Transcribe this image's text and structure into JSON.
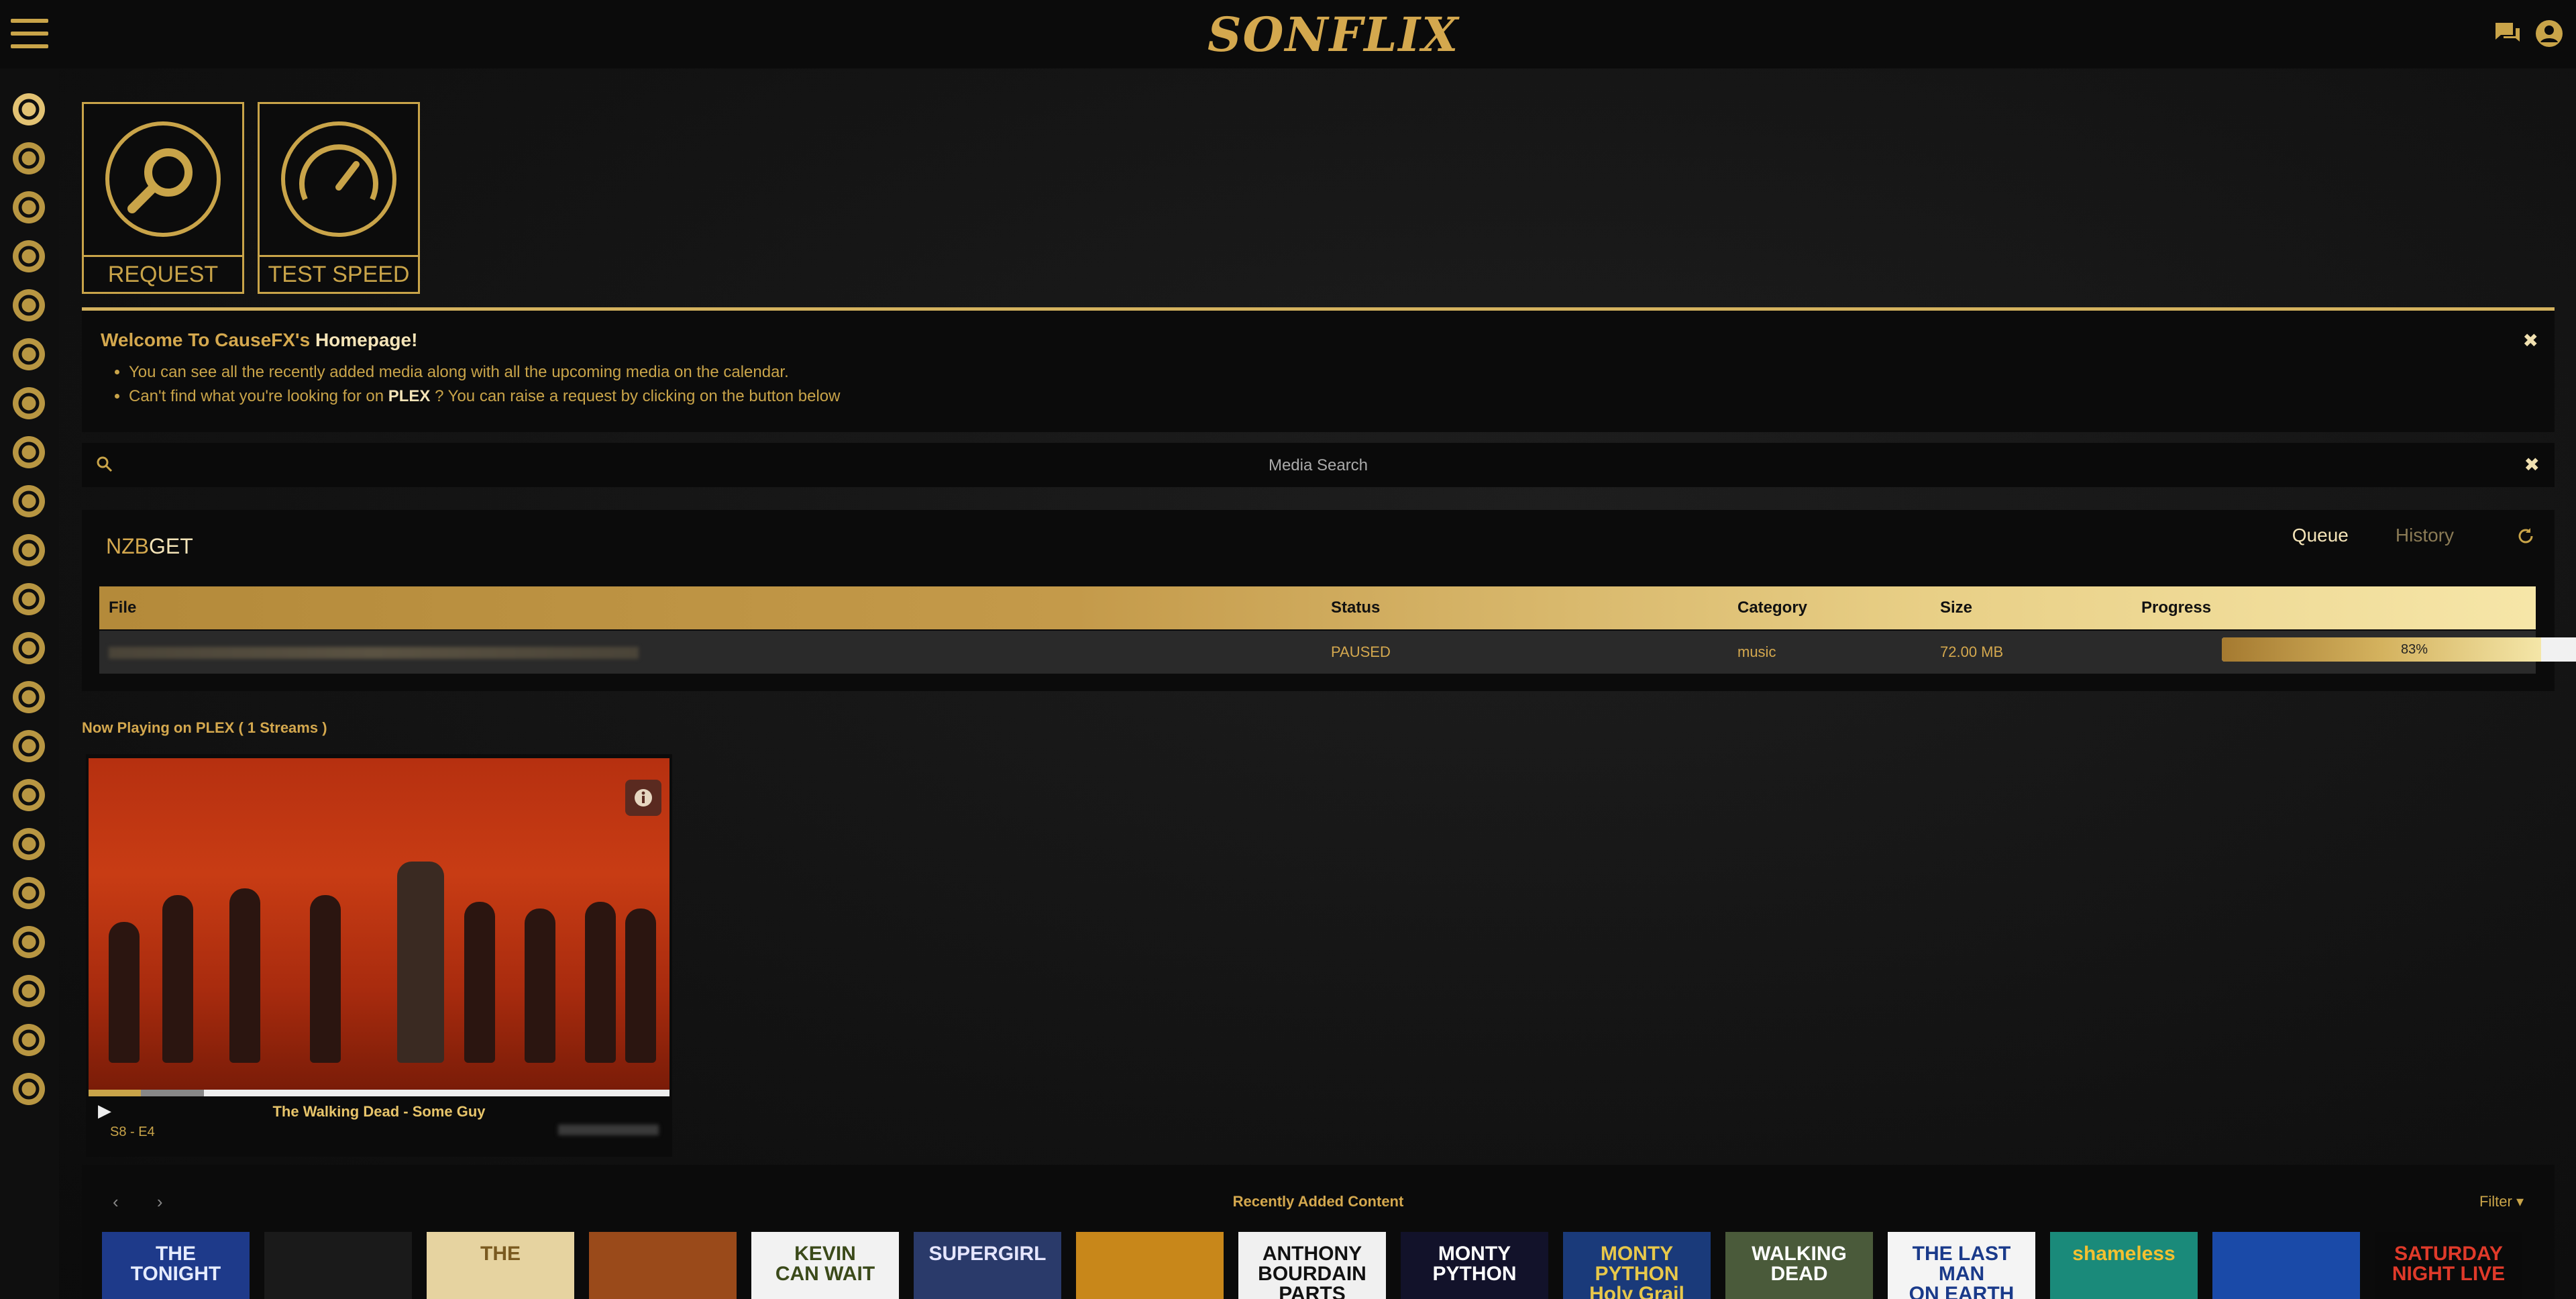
{
  "app": {
    "logo": "SONFLIX"
  },
  "tiles": [
    {
      "label": "REQUEST",
      "icon": "search-icon"
    },
    {
      "label": "TEST SPEED",
      "icon": "speedometer-icon"
    }
  ],
  "welcome": {
    "title_prefix": "Welcome To CauseFX's ",
    "title_bold": "Homepage!",
    "line1": "You can see all the recently added media along with all the upcoming media on the calendar.",
    "line2_prefix": "Can't find what you're looking for on ",
    "line2_bold": "PLEX",
    "line2_suffix": " ? You can raise a request by clicking on the button below",
    "close": "✖"
  },
  "search": {
    "placeholder": "Media Search",
    "close": "✖"
  },
  "nzbget": {
    "title_a": "NZB",
    "title_b": "GET",
    "tabs": [
      "Queue",
      "History"
    ],
    "columns": [
      "File",
      "Status",
      "Category",
      "Size",
      "Progress"
    ],
    "row": {
      "status": "PAUSED",
      "category": "music",
      "size": "72.00 MB",
      "progress_label": "83%",
      "progress": 0.83
    }
  },
  "now_playing": {
    "title": "Now Playing on PLEX ( 1 Streams )",
    "show": "The Walking Dead - Some Guy",
    "episode": "S8 - E4",
    "progress": 0.09
  },
  "recent": {
    "title": "Recently Added Content",
    "filter": "Filter ▾",
    "items": [
      {
        "label": "THE\nTONIGHT",
        "bg": "#1e3a8a",
        "fg": "#e6ecff"
      },
      {
        "label": "",
        "bg": "#1a1a1a",
        "fg": "#fff"
      },
      {
        "label": "THE",
        "bg": "#e6d3a0",
        "fg": "#7a5a20"
      },
      {
        "label": "",
        "bg": "#9a4a1a",
        "fg": "#fff"
      },
      {
        "label": "KEVIN\nCAN WAIT",
        "bg": "#f2f2f2",
        "fg": "#3b4a1a"
      },
      {
        "label": "SUPERGIRL",
        "bg": "#2a3a6a",
        "fg": "#e6e6ff"
      },
      {
        "label": "",
        "bg": "#c8871a",
        "fg": "#fff"
      },
      {
        "label": "ANTHONY\nBOURDAIN\nPARTS",
        "bg": "#f0f0f0",
        "fg": "#111"
      },
      {
        "label": "MONTY\nPYTHON",
        "bg": "#12122a",
        "fg": "#fff"
      },
      {
        "label": "MONTY PYTHON\nHoly Grail",
        "bg": "#1a3a7a",
        "fg": "#e8c84a"
      },
      {
        "label": "WALKING DEAD",
        "bg": "#4a5a3a",
        "fg": "#fff"
      },
      {
        "label": "THE LAST MAN\nON EARTH",
        "bg": "#f4f4f4",
        "fg": "#1a3a8a"
      },
      {
        "label": "shameless",
        "bg": "#1a8a7a",
        "fg": "#f4c030"
      },
      {
        "label": "",
        "bg": "#1a4aa8",
        "fg": "#fff"
      },
      {
        "label": "SATURDAY\nNIGHT LIVE",
        "bg": "#0a0a0a",
        "fg": "#e03a2a"
      }
    ]
  },
  "colors": {
    "accent": "#c9a449",
    "gold_light": "#f4e6a8",
    "bg": "#121212"
  }
}
